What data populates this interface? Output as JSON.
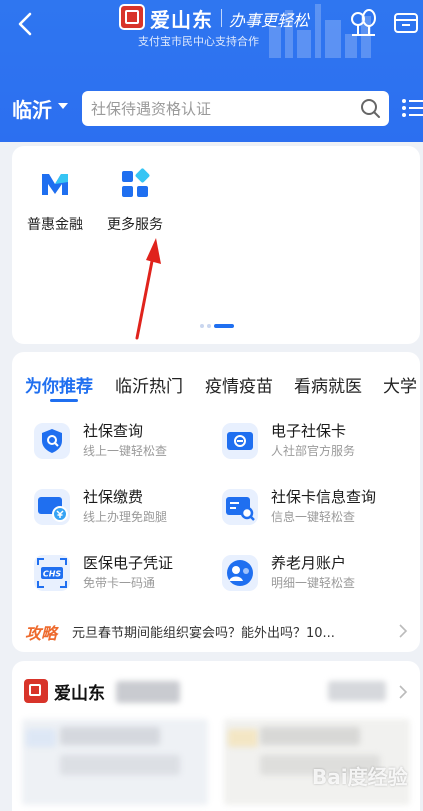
{
  "header": {
    "brand": "爱山东",
    "slogan": "办事更轻松",
    "subtitle": "支付宝市民中心支持合作"
  },
  "location": {
    "city": "临沂"
  },
  "search": {
    "placeholder": "社保待遇资格认证"
  },
  "quick_services": [
    {
      "label": "普惠金融",
      "icon": "m-logo-icon"
    },
    {
      "label": "更多服务",
      "icon": "grid-apps-icon"
    }
  ],
  "tabs": [
    "为你推荐",
    "临沂热门",
    "疫情疫苗",
    "看病就医",
    "大学"
  ],
  "recommend": [
    {
      "title": "社保查询",
      "subtitle": "线上一键轻松查",
      "icon": "shield-icon"
    },
    {
      "title": "电子社保卡",
      "subtitle": "人社部官方服务",
      "icon": "social-card-icon"
    },
    {
      "title": "社保缴费",
      "subtitle": "线上办理免跑腿",
      "icon": "payment-card-icon"
    },
    {
      "title": "社保卡信息查询",
      "subtitle": "信息一键轻松查",
      "icon": "card-search-icon"
    },
    {
      "title": "医保电子凭证",
      "subtitle": "免带卡一码通",
      "icon": "chs-icon"
    },
    {
      "title": "养老月账户",
      "subtitle": "明细一键轻松查",
      "icon": "elder-icon"
    }
  ],
  "tip": {
    "label": "攻略",
    "text": "元旦春节期间能组织宴会吗？能外出吗？10..."
  },
  "section3": {
    "title": "爱山东"
  },
  "watermark": "Bai度经验",
  "colors": {
    "primary": "#2f76f0",
    "accent": "#1f6ff0",
    "tip": "#ee6a2d",
    "arrow": "#e0231c"
  }
}
